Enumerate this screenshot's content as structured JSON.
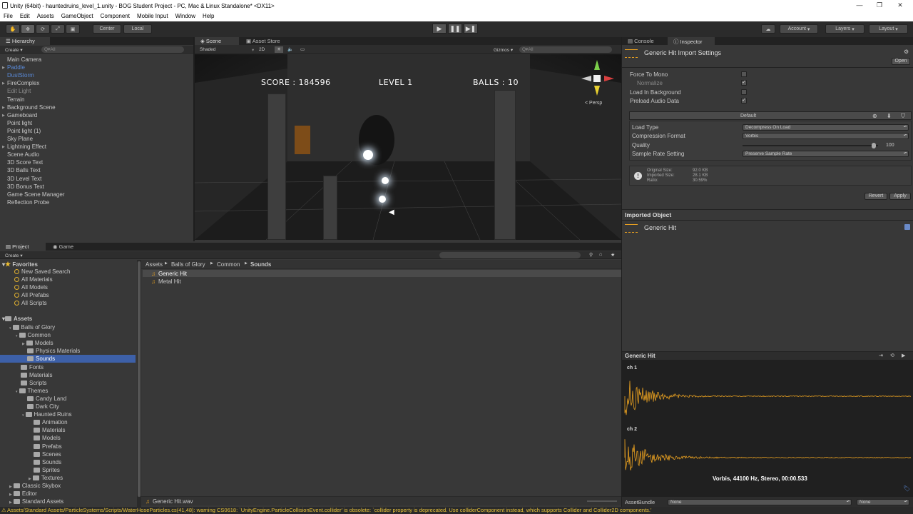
{
  "window": {
    "title": "Unity (64bit) - hauntedruins_level_1.unity - BOG Student Project - PC, Mac & Linux Standalone* <DX11>"
  },
  "menu": [
    "File",
    "Edit",
    "Assets",
    "GameObject",
    "Component",
    "Mobile Input",
    "Window",
    "Help"
  ],
  "toolbar": {
    "pivot": "Center",
    "space": "Local",
    "account": "Account",
    "layers": "Layers",
    "layout": "Layout"
  },
  "hierarchy": {
    "tab": "Hierarchy",
    "create": "Create",
    "search": "Q▾All",
    "items": [
      {
        "label": "Main Camera",
        "style": "normal",
        "arrow": false
      },
      {
        "label": "Paddle",
        "style": "blue",
        "arrow": true
      },
      {
        "label": "DustStorm",
        "style": "blue",
        "arrow": false
      },
      {
        "label": "FireComplex",
        "style": "normal",
        "arrow": true
      },
      {
        "label": "Edit Light",
        "style": "dim",
        "arrow": false
      },
      {
        "label": "Terrain",
        "style": "normal",
        "arrow": false
      },
      {
        "label": "Background Scene",
        "style": "normal",
        "arrow": true
      },
      {
        "label": "Gameboard",
        "style": "normal",
        "arrow": true
      },
      {
        "label": "Point light",
        "style": "normal",
        "arrow": false
      },
      {
        "label": "Point light (1)",
        "style": "normal",
        "arrow": false
      },
      {
        "label": "Sky Plane",
        "style": "normal",
        "arrow": false
      },
      {
        "label": "Lightning Effect",
        "style": "normal",
        "arrow": true
      },
      {
        "label": "Scene Audio",
        "style": "normal",
        "arrow": false
      },
      {
        "label": "3D Score Text",
        "style": "normal",
        "arrow": false
      },
      {
        "label": "3D Balls Text",
        "style": "normal",
        "arrow": false
      },
      {
        "label": "3D Level Text",
        "style": "normal",
        "arrow": false
      },
      {
        "label": "3D Bonus Text",
        "style": "normal",
        "arrow": false
      },
      {
        "label": "Game Scene Manager",
        "style": "normal",
        "arrow": false
      },
      {
        "label": "Reflection Probe",
        "style": "normal",
        "arrow": false
      }
    ]
  },
  "scene": {
    "tab_scene": "Scene",
    "tab_store": "Asset Store",
    "shaded": "Shaded",
    "mode2d": "2D",
    "gizmos": "Gizmos",
    "search": "Q▾All",
    "persp": "< Persp",
    "hud": {
      "score": "SCORE : 184596",
      "level": "LEVEL 1",
      "balls": "BALLS : 10"
    }
  },
  "project": {
    "tab_project": "Project",
    "tab_game": "Game",
    "create": "Create",
    "favorites_label": "Favorites",
    "favorites": [
      "New Saved Search",
      "All Materials",
      "All Models",
      "All Prefabs",
      "All Scripts"
    ],
    "assets_label": "Assets",
    "tree": [
      {
        "label": "Balls of Glory",
        "depth": 1
      },
      {
        "label": "Common",
        "depth": 2
      },
      {
        "label": "Models",
        "depth": 3
      },
      {
        "label": "Physics Materials",
        "depth": 3
      },
      {
        "label": "Sounds",
        "depth": 3
      },
      {
        "label": "Fonts",
        "depth": 2
      },
      {
        "label": "Materials",
        "depth": 2
      },
      {
        "label": "Scripts",
        "depth": 2
      },
      {
        "label": "Themes",
        "depth": 2
      },
      {
        "label": "Candy Land",
        "depth": 3
      },
      {
        "label": "Dark City",
        "depth": 3
      },
      {
        "label": "Haunted Ruins",
        "depth": 3
      },
      {
        "label": "Animation",
        "depth": 4
      },
      {
        "label": "Materials",
        "depth": 4
      },
      {
        "label": "Models",
        "depth": 4
      },
      {
        "label": "Prefabs",
        "depth": 4
      },
      {
        "label": "Scenes",
        "depth": 4
      },
      {
        "label": "Sounds",
        "depth": 4
      },
      {
        "label": "Sprites",
        "depth": 4
      },
      {
        "label": "Textures",
        "depth": 4
      },
      {
        "label": "Classic Skybox",
        "depth": 1
      },
      {
        "label": "Editor",
        "depth": 1
      },
      {
        "label": "Standard Assets",
        "depth": 1
      }
    ],
    "breadcrumb": [
      "Assets",
      "Balls of Glory",
      "Common",
      "Sounds"
    ],
    "files": [
      "Generic Hit",
      "Metal Hit"
    ],
    "selected_path": "Generic Hit.wav"
  },
  "inspector": {
    "tab_console": "Console",
    "tab_inspector": "Inspector",
    "title": "Generic Hit Import Settings",
    "open": "Open",
    "force_to_mono": "Force To Mono",
    "normalize": "Normalize",
    "load_in_background": "Load In Background",
    "preload_audio_data": "Preload Audio Data",
    "platform_default": "Default",
    "load_type_label": "Load Type",
    "load_type": "Decompress On Load",
    "compression_label": "Compression Format",
    "compression": "Vorbis",
    "quality_label": "Quality",
    "quality": "100",
    "quality_fraction": 0.97,
    "sample_rate_label": "Sample Rate Setting",
    "sample_rate": "Preserve Sample Rate",
    "info_original_label": "Original Size:",
    "info_original": "92.0 KB",
    "info_imported_label": "Imported Size:",
    "info_imported": "28.1 KB",
    "info_ratio_label": "Ratio:",
    "info_ratio": "30.59%",
    "revert": "Revert",
    "apply": "Apply",
    "imported_object": "Imported Object",
    "imported_name": "Generic Hit",
    "preview_title": "Generic Hit",
    "ch1": "ch 1",
    "ch2": "ch 2",
    "audio_info": "Vorbis, 44100 Hz, Stereo, 00:00.533",
    "asset_bundle_label": "AssetBundle",
    "asset_bundle": "None",
    "asset_bundle_variant": "None",
    "accent": "#e8a020"
  },
  "status": "Assets/Standard Assets/ParticleSystems/Scripts/WaterHoseParticles.cs(41,48): warning CS0618: `UnityEngine.ParticleCollisionEvent.collider' is obsolete: `collider property is deprecated. Use colliderComponent instead, which supports Collider and Collider2D components.'"
}
